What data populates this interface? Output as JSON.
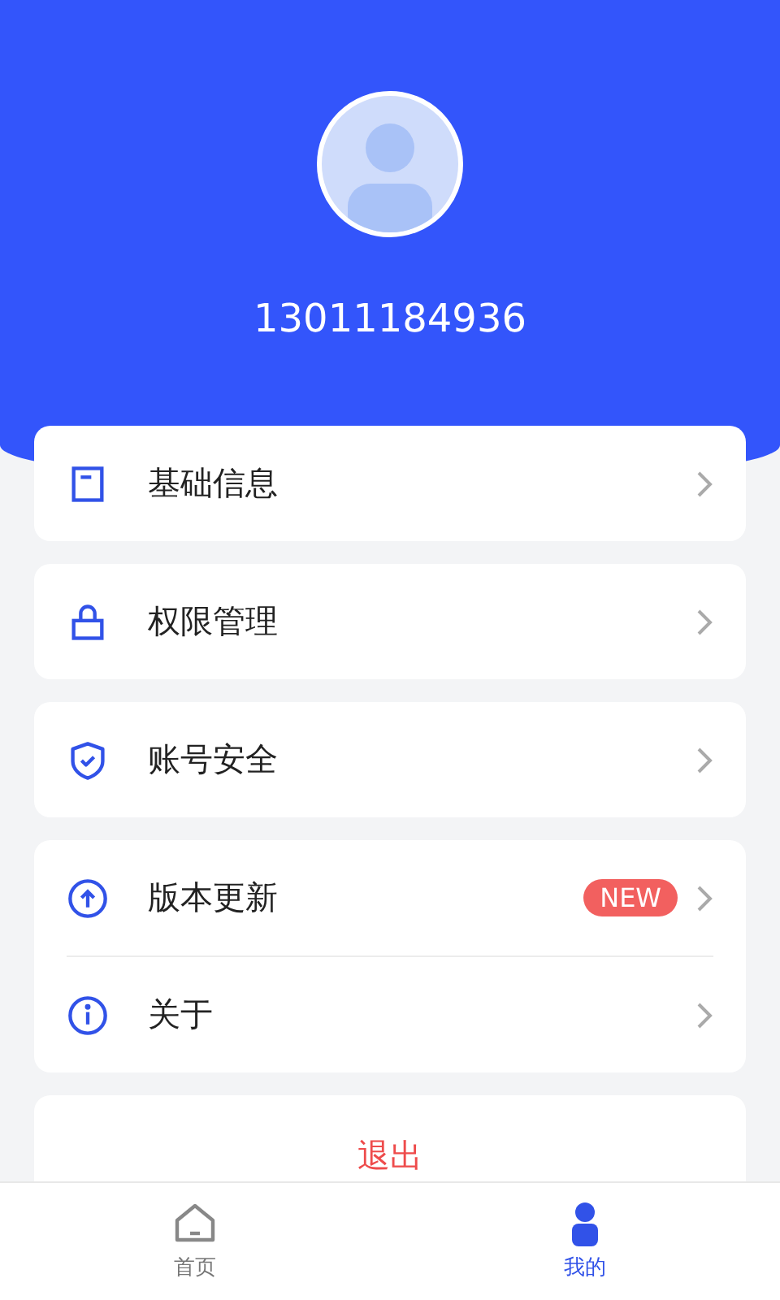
{
  "profile": {
    "phone": "13011184936"
  },
  "menu_groups": [
    {
      "items": [
        {
          "label": "基础信息"
        }
      ]
    },
    {
      "items": [
        {
          "label": "权限管理"
        }
      ]
    },
    {
      "items": [
        {
          "label": "账号安全"
        }
      ]
    },
    {
      "items": [
        {
          "label": "版本更新",
          "badge": "NEW"
        },
        {
          "label": "关于"
        }
      ]
    }
  ],
  "logout_button": {
    "label": "退出"
  },
  "tab_bar": [
    {
      "label": "首页",
      "selected": false
    },
    {
      "label": "我的",
      "selected": true
    }
  ]
}
